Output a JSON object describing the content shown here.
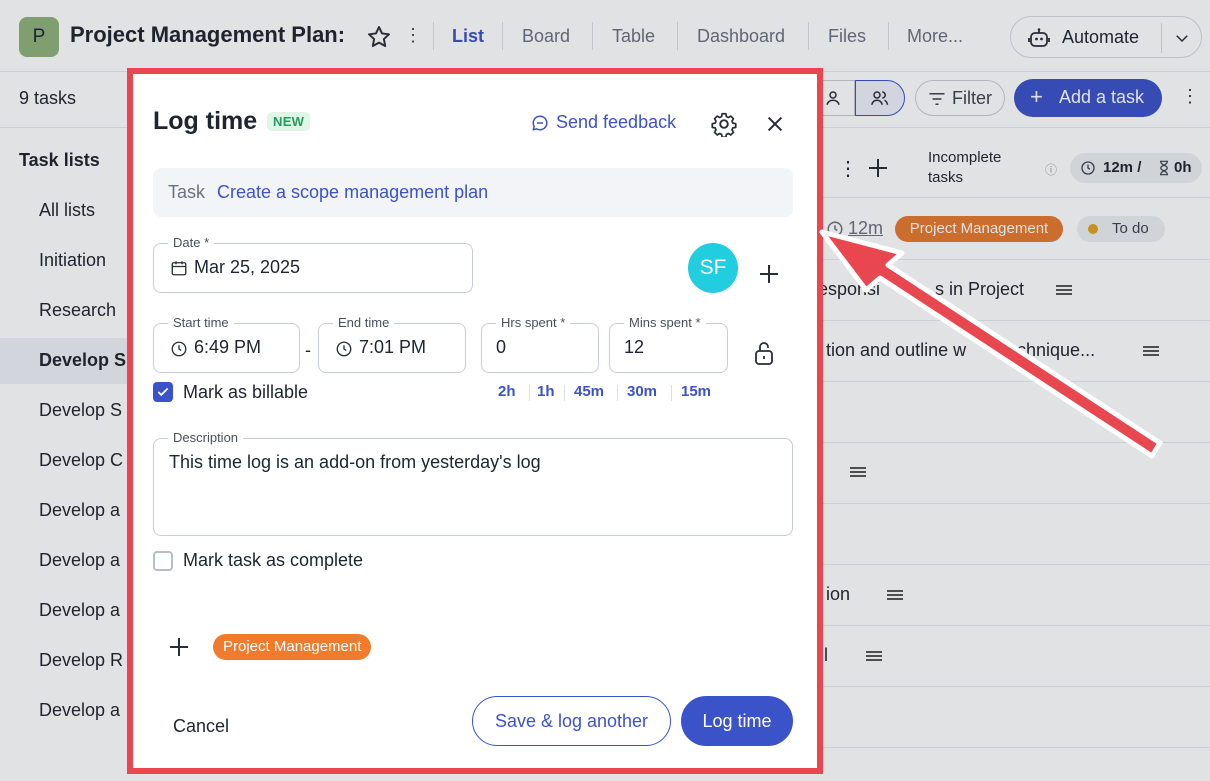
{
  "header": {
    "project_initial": "P",
    "project_title": "Project Management Plan:",
    "tabs": [
      "List",
      "Board",
      "Table",
      "Dashboard",
      "Files",
      "More..."
    ],
    "active_tab": "List",
    "automate_label": "Automate"
  },
  "subbar": {
    "task_count": "9 tasks",
    "filter_label": "Filter",
    "add_task_label": "Add a task"
  },
  "sidebar": {
    "heading": "Task lists",
    "items": [
      "All lists",
      "Initiation",
      "Research",
      "Develop S",
      "Develop S",
      "Develop C",
      "Develop a",
      "Develop a",
      "Develop a",
      "Develop R",
      "Develop a"
    ],
    "active_index": 3
  },
  "right_panel": {
    "incomplete_line1": "Incomplete",
    "incomplete_line2": "tasks",
    "time_summary": "12m /",
    "estimate": "0h",
    "row_time": "12m",
    "row_tag": "Project Management",
    "row_status": "To do",
    "rows": [
      "esponsi",
      "s in Project",
      "tion and outline w",
      "echnique...",
      "ion",
      "l"
    ]
  },
  "modal": {
    "title": "Log time",
    "badge": "NEW",
    "feedback_label": "Send feedback",
    "task_key": "Task",
    "task_value": "Create a scope management plan",
    "date_label": "Date *",
    "date_value": "Mar 25, 2025",
    "assignee_initials": "SF",
    "start_label": "Start time",
    "start_value": "6:49 PM",
    "end_label": "End time",
    "end_value": "7:01 PM",
    "hrs_label": "Hrs spent *",
    "hrs_value": "0",
    "mins_label": "Mins spent *",
    "mins_value": "12",
    "quick_times": [
      "2h",
      "1h",
      "45m",
      "30m",
      "15m"
    ],
    "billable_label": "Mark as billable",
    "billable_checked": true,
    "description_label": "Description",
    "description_value": "This time log is an add-on from yesterday's log",
    "complete_label": "Mark task as complete",
    "complete_checked": false,
    "tag": "Project Management",
    "cancel_label": "Cancel",
    "save_another_label": "Save & log another",
    "submit_label": "Log time"
  },
  "colors": {
    "accent": "#3b53c9",
    "highlight_border": "#e8474f",
    "tag_orange": "#f07b2c",
    "avatar_cyan": "#22cde0"
  }
}
